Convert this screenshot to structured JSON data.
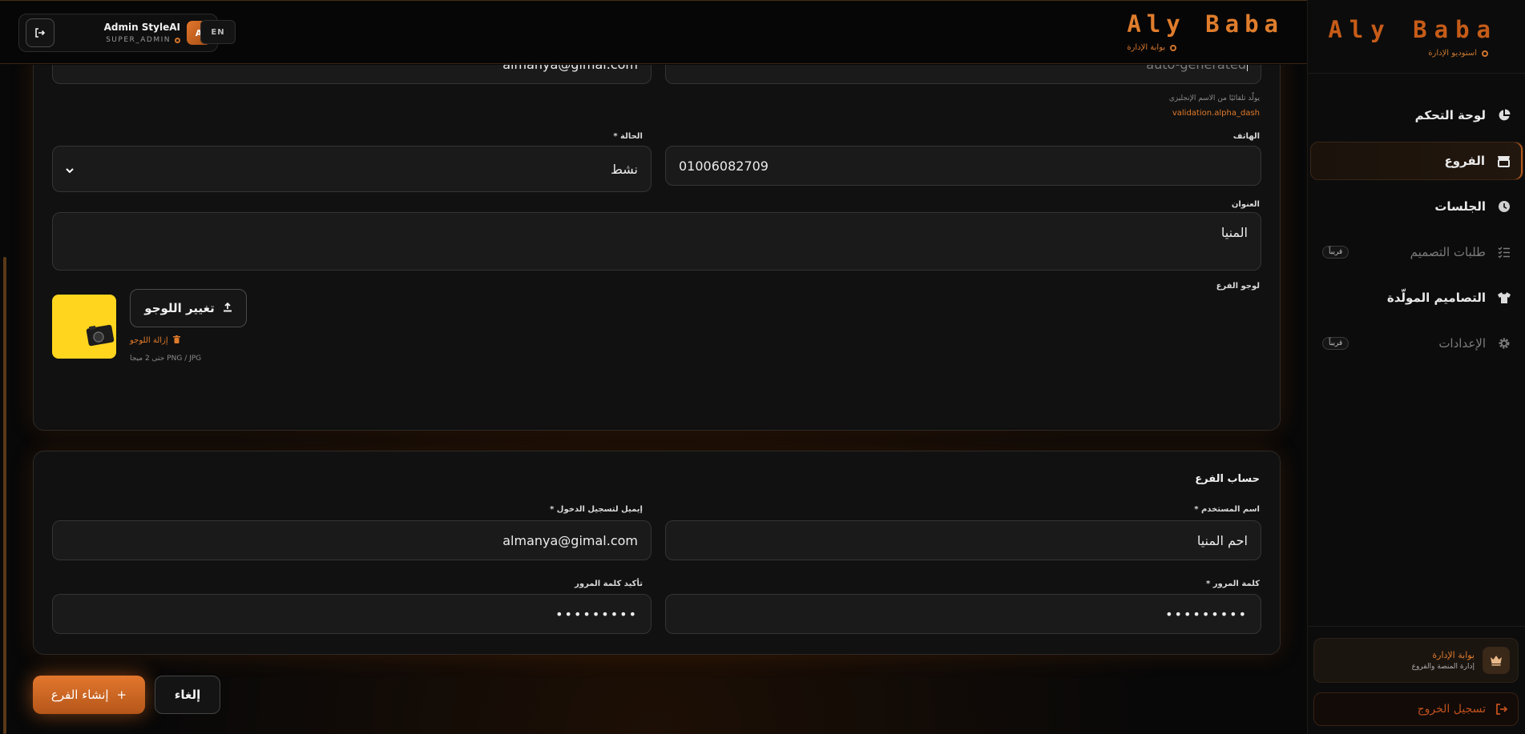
{
  "brand": {
    "name": "Aly Baba",
    "sidebar_subtitle": "استوديو الإدارة",
    "topbar_subtitle": "بوابة الإدارة"
  },
  "header": {
    "user_name": "Admin StyleAI",
    "user_role": "SUPER_ADMIN",
    "avatar_letter": "A",
    "language": "EN"
  },
  "sidebar": {
    "items": [
      {
        "label": "لوحة التحكم",
        "icon": "pie-chart-icon",
        "state": "normal"
      },
      {
        "label": "الفروع",
        "icon": "store-icon",
        "state": "active"
      },
      {
        "label": "الجلسات",
        "icon": "clock-icon",
        "state": "normal"
      },
      {
        "label": "طلبات التصميم",
        "icon": "list-check-icon",
        "state": "disabled",
        "badge": "قريباً"
      },
      {
        "label": "التصاميم المولّدة",
        "icon": "shirt-icon",
        "state": "normal"
      },
      {
        "label": "الإعدادات",
        "icon": "gear-icon",
        "state": "disabled",
        "badge": "قريباً"
      }
    ],
    "portal_card": {
      "title": "بوابة الإدارة",
      "subtitle": "إدارة المنصة والفروع"
    },
    "logout_label": "تسجيل الخروج"
  },
  "branch_form": {
    "email_value": "almanya@gimal.com",
    "slug_placeholder": "auto-generated",
    "slug_hint": "يولّد تلقائيًا من الاسم الإنجليزي",
    "slug_error": "validation.alpha_dash",
    "phone_label": "الهاتف",
    "phone_value": "01006082709",
    "status_label": "الحالة *",
    "status_value": "نشط",
    "address_label": "العنوان",
    "address_value": "المنيا",
    "logo_label": "لوجو الفرع",
    "change_logo_label": "تغيير اللوجو",
    "remove_logo_label": "إزالة اللوجو",
    "logo_note": "PNG / JPG حتى 2 ميجا"
  },
  "account_form": {
    "section_title": "حساب الفرع",
    "username_label": "اسم المستخدم *",
    "username_value": "احم المنيا",
    "login_email_label": "إيميل لتسجيل الدخول *",
    "login_email_value": "almanya@gimal.com",
    "password_label": "كلمة المرور *",
    "password_value": "•••••••••",
    "confirm_password_label": "تأكيد كلمة المرور",
    "confirm_password_value": "•••••••••"
  },
  "actions": {
    "create_label": "إنشاء الفرع",
    "cancel_label": "إلغاء"
  },
  "colors": {
    "accent": "#e07a2a",
    "background": "#080808",
    "card": "#111111"
  }
}
